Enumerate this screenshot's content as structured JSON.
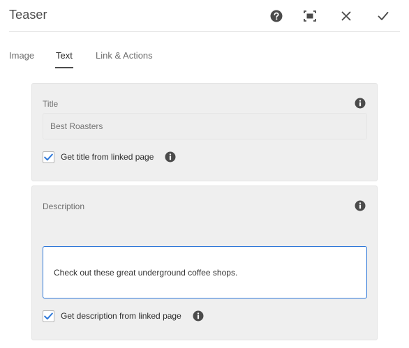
{
  "dialog": {
    "title": "Teaser"
  },
  "header_actions": {
    "help": "help-icon",
    "fullscreen": "fullscreen-icon",
    "close": "close-icon",
    "done": "checkmark-icon"
  },
  "tabs": [
    {
      "label": "Image",
      "active": false
    },
    {
      "label": "Text",
      "active": true
    },
    {
      "label": "Link & Actions",
      "active": false
    }
  ],
  "title_field": {
    "label": "Title",
    "placeholder": "Best Roasters",
    "value": "",
    "checkbox_label": "Get title from linked page",
    "checked": true
  },
  "description_field": {
    "label": "Description",
    "value": "Check out these great underground coffee shops.",
    "checkbox_label": "Get description from linked page",
    "checked": true
  },
  "colors": {
    "accent": "#2d77d8",
    "panel_bg": "#efefef",
    "icon": "#4b4b4b"
  }
}
